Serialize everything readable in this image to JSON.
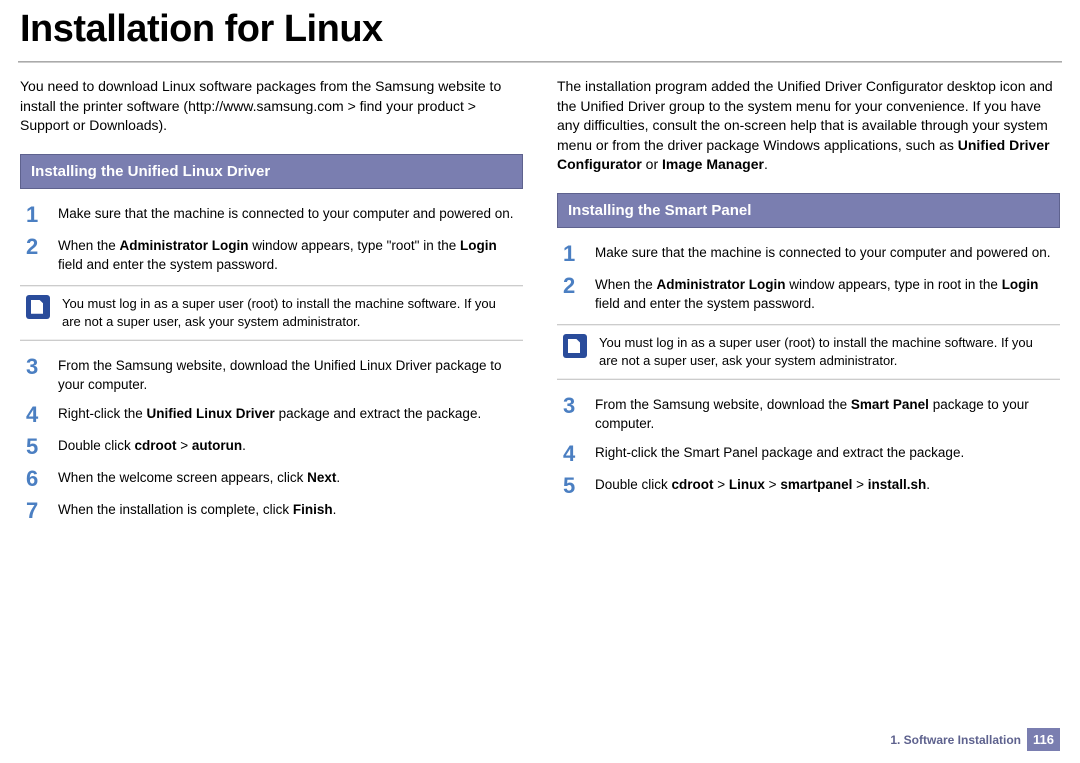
{
  "title": "Installation for Linux",
  "left": {
    "intro": "You need to download Linux software packages from the Samsung website to install the printer software (http://www.samsung.com > find your product > Support or Downloads).",
    "section_heading": "Installing the Unified Linux Driver",
    "steps": [
      {
        "n": "1",
        "text": "Make sure that the machine is connected to your computer and powered on."
      },
      {
        "n": "2",
        "html": "When the <b>Administrator Login</b> window appears, type \"root\" in the <b>Login</b> field and enter the system password."
      }
    ],
    "note": "You must log in as a super user (root) to install the machine software. If you are not a super user, ask your system administrator.",
    "steps2": [
      {
        "n": "3",
        "text": "From the Samsung website, download the Unified Linux Driver package to your computer."
      },
      {
        "n": "4",
        "html": "Right-click the <b>Unified Linux Driver</b> package and extract the package."
      },
      {
        "n": "5",
        "html": "Double click <b>cdroot</b> > <b>autorun</b>."
      },
      {
        "n": "6",
        "html": "When the welcome screen appears, click <b>Next</b>."
      },
      {
        "n": "7",
        "html": "When the installation is complete, click <b>Finish</b>."
      }
    ]
  },
  "right": {
    "intro_html": "The installation program added the Unified Driver Configurator desktop icon and the Unified Driver group to the system menu for your convenience. If you have any difficulties, consult the on-screen help that is available through your system menu or from the driver package Windows applications, such as <b>Unified Driver Configurator</b> or <b>Image Manager</b>.",
    "section_heading": "Installing the Smart Panel",
    "steps": [
      {
        "n": "1",
        "text": "Make sure that the machine is connected to your computer and powered on."
      },
      {
        "n": "2",
        "html": "When the <b>Administrator Login</b> window appears, type in root in the <b>Login</b> field and enter the system password."
      }
    ],
    "note": "You must log in as a super user (root) to install the machine software. If you are not a super user, ask your system administrator.",
    "steps2": [
      {
        "n": "3",
        "html": "From the Samsung website, download the <b>Smart Panel</b> package to your computer."
      },
      {
        "n": "4",
        "text": "Right-click the Smart Panel package and extract the package."
      },
      {
        "n": "5",
        "html": "Double click <b>cdroot</b> > <b>Linux</b> > <b>smartpanel</b> > <b>install.sh</b>."
      }
    ]
  },
  "footer": {
    "chapter": "1.  Software Installation",
    "page": "116"
  }
}
